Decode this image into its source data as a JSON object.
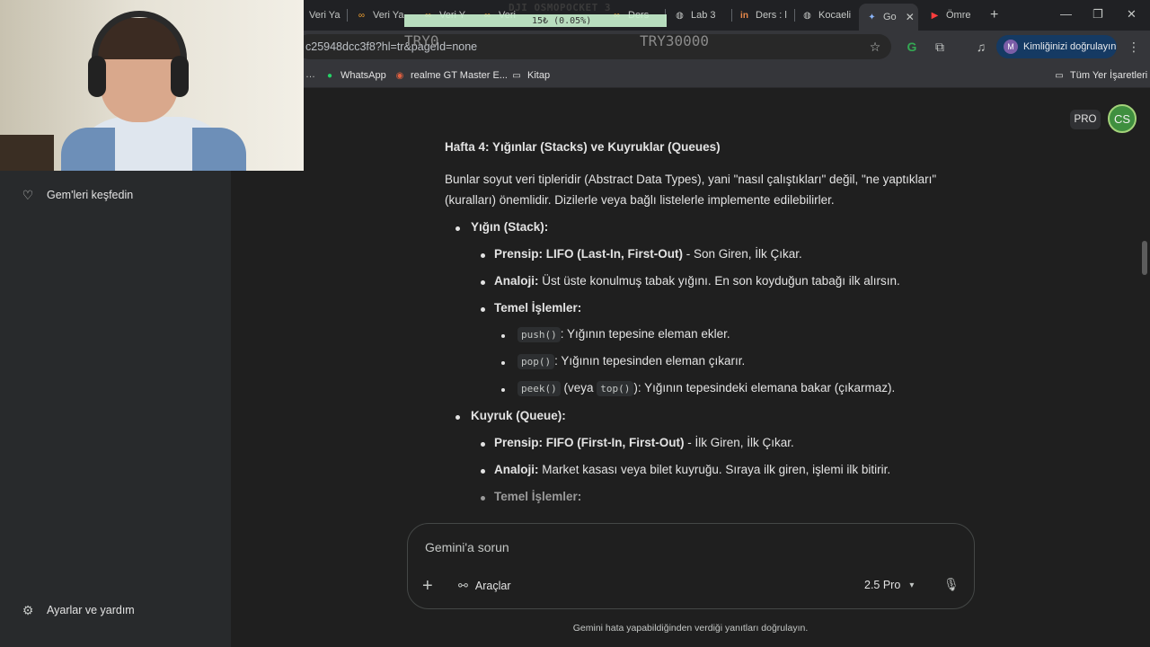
{
  "browser": {
    "tabs": [
      {
        "label": "Veri Ya",
        "icon": "page-icon"
      },
      {
        "label": "Veri Ya",
        "icon": "infinity-icon"
      },
      {
        "label": "Veri Y",
        "icon": "infinity-icon"
      },
      {
        "label": "Veri",
        "icon": "infinity-icon"
      },
      {
        "label": "Ders",
        "icon": "infinity-icon"
      },
      {
        "label": "Lab 3",
        "icon": "globe-icon"
      },
      {
        "label": "Ders : l",
        "icon": "in-icon"
      },
      {
        "label": "Kocaeli",
        "icon": "globe-icon"
      },
      {
        "label": "Go",
        "icon": "gemini-icon",
        "active": true
      },
      {
        "label": "Ömre",
        "icon": "youtube-icon"
      }
    ],
    "url": "c25948dcc3f8?hl=tr&pageId=none",
    "profile_label": "Kimliğinizi doğrulayın",
    "profile_initial": "M",
    "bookmarks": [
      {
        "label": "WhatsApp",
        "icon": "whatsapp-icon"
      },
      {
        "label": "realme GT Master E...",
        "icon": "realme-icon"
      },
      {
        "label": "Kitap",
        "icon": "folder-icon"
      }
    ],
    "all_bookmarks_label": "Tüm Yer İşaretleri"
  },
  "recording": {
    "title": "DJI OSMOPOCKET 3",
    "value": "15₺ (0.05%)",
    "low": "TRY0",
    "high": "TRY30000"
  },
  "sidebar": {
    "explore_gems": "Gem'leri keşfedin",
    "settings": "Ayarlar ve yardım"
  },
  "header": {
    "pro_badge": "PRO",
    "avatar_initials": "CS"
  },
  "response": {
    "heading": "Hafta 4: Yığınlar (Stacks) ve Kuyruklar (Queues)",
    "intro_line1": "Bunlar soyut veri tipleridir (Abstract Data Types), yani \"nasıl çalıştıkları\" değil, \"ne yaptıkları\"",
    "intro_line2": "(kuralları) önemlidir. Dizilerle veya bağlı listelerle implemente edilebilirler.",
    "stack": {
      "title": "Yığın (Stack):",
      "principle_label": "Prensip: LIFO (Last-In, First-Out)",
      "principle_text": " - Son Giren, İlk Çıkar.",
      "analogy_label": "Analoji:",
      "analogy_text": " Üst üste konulmuş tabak yığını. En son koyduğun tabağı ilk alırsın.",
      "ops_label": "Temel İşlemler:",
      "op1_code": "push()",
      "op1_text": ": Yığının tepesine eleman ekler.",
      "op2_code": "pop()",
      "op2_text": ": Yığının tepesinden eleman çıkarır.",
      "op3_code": "peek()",
      "op3_mid": " (veya ",
      "op3_code2": "top()",
      "op3_text": "): Yığının tepesindeki elemana bakar (çıkarmaz)."
    },
    "queue": {
      "title": "Kuyruk (Queue):",
      "principle_label": "Prensip: FIFO (First-In, First-Out)",
      "principle_text": " - İlk Giren, İlk Çıkar.",
      "analogy_label": "Analoji:",
      "analogy_text": " Market kasası veya bilet kuyruğu. Sıraya ilk giren, işlemi ilk bitirir.",
      "ops_label": "Temel İşlemler:"
    }
  },
  "input": {
    "placeholder": "Gemini'a sorun",
    "tools_label": "Araçlar",
    "model_label": "2.5 Pro"
  },
  "footer": {
    "disclaimer": "Gemini hata yapabildiğinden verdiği yanıtları doğrulayın."
  }
}
